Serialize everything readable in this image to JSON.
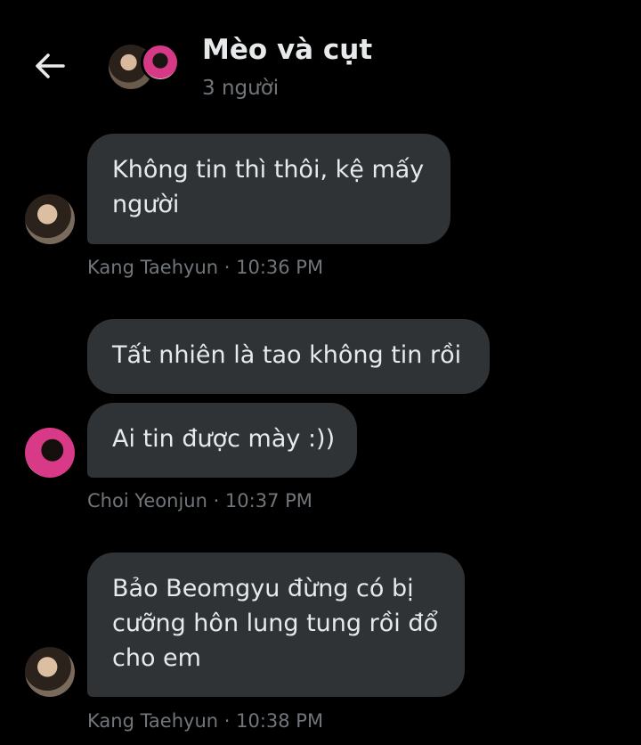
{
  "header": {
    "title": "Mèo và cụt",
    "subtitle": "3 người"
  },
  "messages": [
    {
      "text": "Không tin thì thôi, kệ mấy người",
      "sender": "Kang Taehyun",
      "time": "10:36 PM",
      "meta": "Kang Taehyun · 10:36 PM"
    },
    {
      "text": "Tất nhiên là tao không tin rồi",
      "sender": "Choi Yeonjun"
    },
    {
      "text": "Ai tin được mày :))",
      "sender": "Choi Yeonjun",
      "time": "10:37 PM",
      "meta": "Choi Yeonjun · 10:37 PM"
    },
    {
      "text": "Bảo Beomgyu đừng có bị cưỡng hôn lung tung rồi đổ cho em",
      "sender": "Kang Taehyun",
      "time": "10:38 PM",
      "meta": "Kang Taehyun · 10:38 PM"
    }
  ],
  "colors": {
    "background": "#000000",
    "bubble": "#2f3336",
    "text": "#e7e9ea",
    "secondary_text": "#71767b"
  },
  "icons": {
    "back": "arrow-left-icon"
  }
}
